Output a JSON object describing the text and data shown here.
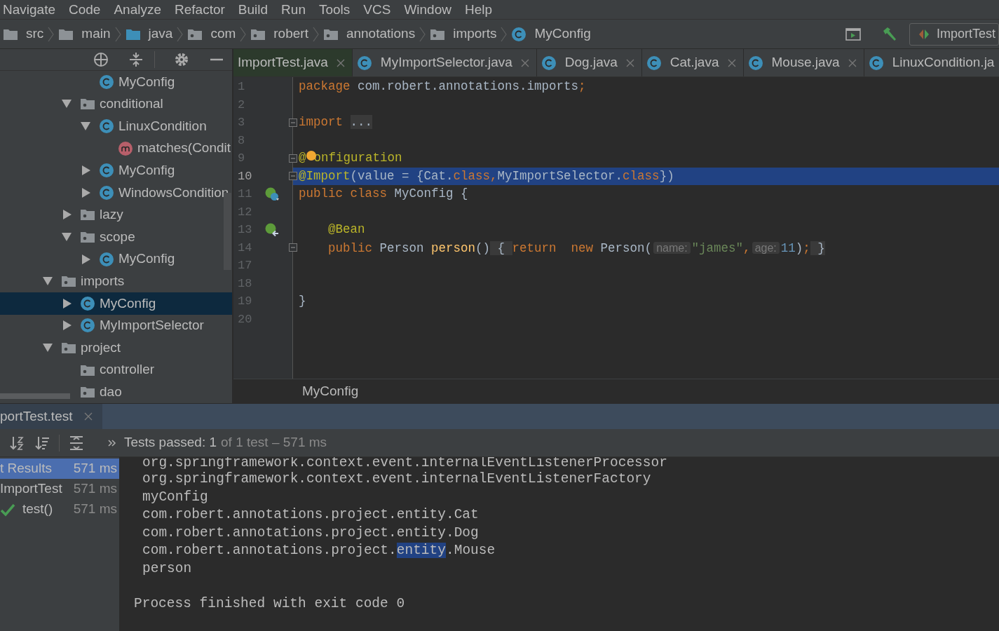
{
  "menu": [
    {
      "label": "Navigate"
    },
    {
      "label": "Code"
    },
    {
      "label": "Analyze"
    },
    {
      "label": "Refactor"
    },
    {
      "label": "Build"
    },
    {
      "label": "Run"
    },
    {
      "label": "Tools"
    },
    {
      "label": "VCS"
    },
    {
      "label": "Window"
    },
    {
      "label": "Help"
    }
  ],
  "breadcrumbs": [
    {
      "label": "src",
      "kind": "folder"
    },
    {
      "label": "main",
      "kind": "folder"
    },
    {
      "label": "java",
      "kind": "source"
    },
    {
      "label": "com",
      "kind": "package"
    },
    {
      "label": "robert",
      "kind": "package"
    },
    {
      "label": "annotations",
      "kind": "package"
    },
    {
      "label": "imports",
      "kind": "package"
    },
    {
      "label": "MyConfig",
      "kind": "class"
    }
  ],
  "toolbar": {
    "run_configuration": "ImportTest"
  },
  "project_tree": [
    {
      "children": [
        {
          "children": [
            {
              "label": "MyConfig",
              "kind": "class",
              "selected": false
            }
          ]
        },
        {
          "label": "conditional",
          "kind": "package",
          "expanded": true,
          "selected": false,
          "children": [
            {
              "label": "LinuxCondition",
              "kind": "class",
              "expanded": true,
              "selected": false,
              "children": [
                {
                  "label": "matches(Condit",
                  "kind": "method",
                  "selected": false
                }
              ]
            },
            {
              "label": "MyConfig",
              "kind": "class",
              "expanded": false,
              "selected": false
            },
            {
              "label": "WindowsCondition",
              "kind": "class",
              "expanded": false,
              "selected": false
            }
          ]
        },
        {
          "label": "lazy",
          "kind": "package",
          "expanded": false,
          "selected": false
        },
        {
          "label": "scope",
          "kind": "package",
          "expanded": true,
          "selected": false,
          "children": [
            {
              "label": "MyConfig",
              "kind": "class",
              "expanded": false,
              "selected": false
            }
          ]
        }
      ]
    },
    {
      "label": "imports",
      "kind": "package",
      "expanded": true,
      "selected": false,
      "children": [
        {
          "label": "MyConfig",
          "kind": "class",
          "expanded": false,
          "selected": true
        },
        {
          "label": "MyImportSelector",
          "kind": "class",
          "expanded": false,
          "selected": false
        }
      ]
    },
    {
      "label": "project",
      "kind": "package",
      "expanded": true,
      "selected": false,
      "children": [
        {
          "label": "controller",
          "kind": "package",
          "selected": false
        },
        {
          "label": "dao",
          "kind": "package",
          "selected": false
        }
      ]
    }
  ],
  "editor": {
    "tabs": [
      {
        "label": "ImportTest.java",
        "icon": false,
        "closable": true,
        "selected": true
      },
      {
        "label": "MyImportSelector.java",
        "icon": true,
        "closable": true,
        "selected": false
      },
      {
        "label": "Dog.java",
        "icon": true,
        "closable": true,
        "selected": false
      },
      {
        "label": "Cat.java",
        "icon": true,
        "closable": true,
        "selected": false
      },
      {
        "label": "Mouse.java",
        "icon": true,
        "closable": true,
        "selected": false
      },
      {
        "label": "LinuxCondition.ja",
        "icon": true,
        "closable": false,
        "selected": false
      }
    ],
    "lines": [
      {
        "number": "1",
        "tokens": [
          {
            "kind": "kw",
            "text": "package"
          },
          {
            "kind": "plain",
            "text": " com.robert.annotations.imports"
          },
          {
            "kind": "kw",
            "text": ";"
          }
        ]
      },
      {
        "number": "2"
      },
      {
        "number": "3",
        "fold": true,
        "tokens": [
          {
            "kind": "kw",
            "text": "import "
          },
          {
            "kind": "folded",
            "text": "..."
          }
        ]
      },
      {
        "number": "8"
      },
      {
        "number": "9",
        "fold": true,
        "tokens": [
          {
            "kind": "ann",
            "text": "@"
          },
          {
            "kind": "bulb"
          },
          {
            "kind": "ann",
            "text": "onfiguration"
          }
        ]
      },
      {
        "number": "10",
        "fold": true,
        "current": true,
        "tokens": [
          {
            "kind": "ann",
            "text": "@Import"
          },
          {
            "kind": "plain",
            "text": "(value = {Cat."
          },
          {
            "kind": "kw",
            "text": "class"
          },
          {
            "kind": "kw",
            "text": ","
          },
          {
            "kind": "plain",
            "text": "MyImportSelector."
          },
          {
            "kind": "kw",
            "text": "class"
          },
          {
            "kind": "plain",
            "text": "})"
          }
        ]
      },
      {
        "number": "11",
        "kind": "bean_class",
        "tokens": [
          {
            "kind": "kw",
            "text": "public class"
          },
          {
            "kind": "plain",
            "text": " MyConfig {"
          }
        ]
      },
      {
        "number": "12"
      },
      {
        "number": "13",
        "kind": "bean_method",
        "indented": true,
        "tokens": [
          {
            "kind": "ann",
            "text": "@Bean"
          }
        ]
      },
      {
        "number": "14",
        "fold": true,
        "indented": true,
        "tokens": [
          {
            "kind": "kw",
            "text": "public"
          },
          {
            "kind": "plain",
            "text": " Person "
          },
          {
            "kind": "fn",
            "text": "person"
          },
          {
            "kind": "plain",
            "text": "()"
          },
          {
            "kind": "folded",
            "text": " { "
          },
          {
            "kind": "kw",
            "text": "return  "
          },
          {
            "kind": "kw",
            "text": "new"
          },
          {
            "kind": "plain",
            "text": " Person("
          },
          {
            "kind": "hint",
            "text": "name:"
          },
          {
            "kind": "str",
            "text": "\"james\""
          },
          {
            "kind": "kw",
            "text": ","
          },
          {
            "kind": "hint",
            "text": "age:"
          },
          {
            "kind": "num",
            "text": "11"
          },
          {
            "kind": "plain",
            "text": ")"
          },
          {
            "kind": "kw",
            "text": ";"
          },
          {
            "kind": "folded",
            "text": " }"
          }
        ]
      },
      {
        "number": "17"
      },
      {
        "number": "18"
      },
      {
        "number": "19",
        "tokens": [
          {
            "kind": "plain",
            "text": "}"
          }
        ]
      },
      {
        "number": "20"
      }
    ],
    "breadcrumb": "MyConfig"
  },
  "run_panel": {
    "tab": {
      "label": "portTest.test",
      "selected": true
    },
    "status": {
      "summary": "Tests passed: 1",
      "detail": "of 1 test – 571 ms"
    },
    "results": [
      {
        "label": "t Results",
        "time": "571 ms",
        "kind": "root",
        "selected": true
      },
      {
        "label": "ImportTest",
        "time": "571 ms",
        "kind": "class",
        "selected": false
      },
      {
        "label": "test()",
        "time": "571 ms",
        "kind": "passed",
        "selected": false
      }
    ],
    "console": {
      "lines": [
        [
          {
            "text": "org.springframework.context.event.internalEventListenerProcessor",
            "highlighted": false
          }
        ],
        [
          {
            "text": "org.springframework.context.event.internalEventListenerFactory",
            "highlighted": false
          }
        ],
        [
          {
            "text": "myConfig",
            "highlighted": false
          }
        ],
        [
          {
            "text": "com.robert.annotations.project.entity.Cat",
            "highlighted": false
          }
        ],
        [
          {
            "text": "com.robert.annotations.project.entity.Dog",
            "highlighted": false
          }
        ],
        [
          {
            "text": "com.robert.annotations.project.",
            "highlighted": false
          },
          {
            "text": "entity",
            "highlighted": true
          },
          {
            "text": ".Mouse",
            "highlighted": false
          }
        ],
        [
          {
            "text": "person",
            "highlighted": false
          }
        ]
      ],
      "exit_message": "Process finished with exit code 0"
    }
  }
}
